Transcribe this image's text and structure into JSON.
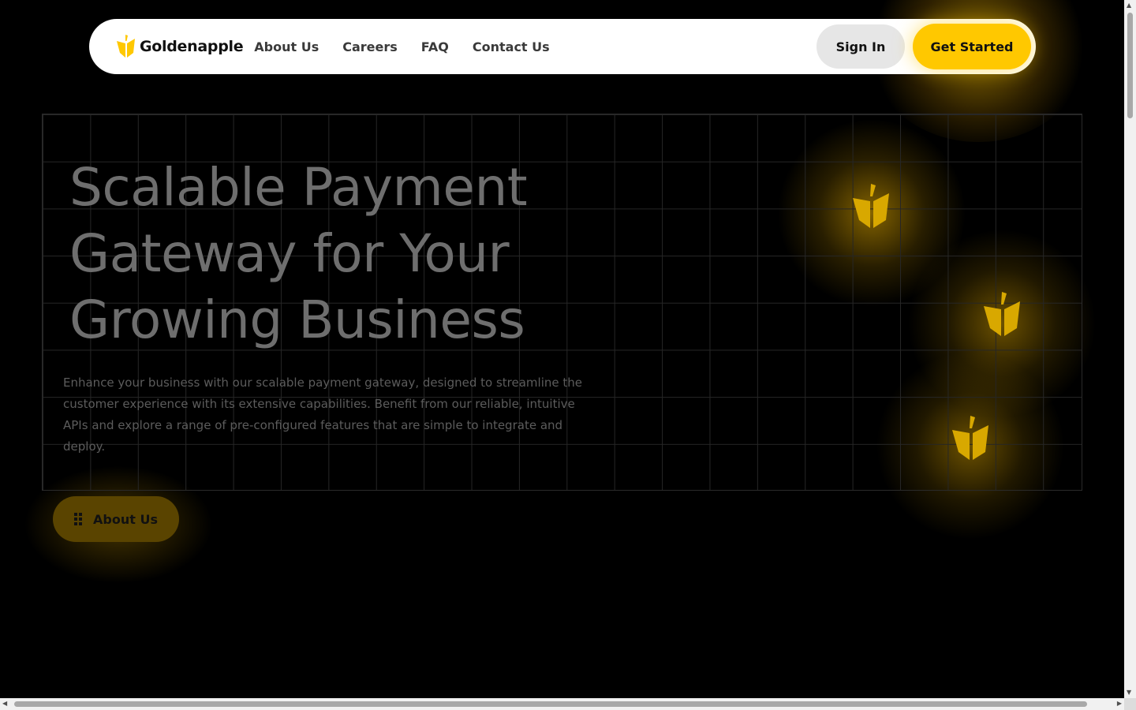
{
  "brand": {
    "name": "Goldenapple",
    "accent_color": "#ffc800"
  },
  "nav": {
    "links": [
      "About Us",
      "Careers",
      "FAQ",
      "Contact Us"
    ],
    "sign_in_label": "Sign In",
    "get_started_label": "Get Started"
  },
  "hero": {
    "title_lines": [
      "Scalable Payment",
      "Gateway for Your",
      "Growing Business"
    ],
    "description": "Enhance your business with our scalable payment gateway, designed to streamline the customer experience with its extensive capabilities. Benefit from our reliable, intuitive APIs and explore a range of pre-configured features that are simple to integrate and deploy.",
    "cta_label": "About Us",
    "cta_icon": "grid-dots-icon"
  },
  "decorations": {
    "icon": "leaf-logo-icon"
  }
}
